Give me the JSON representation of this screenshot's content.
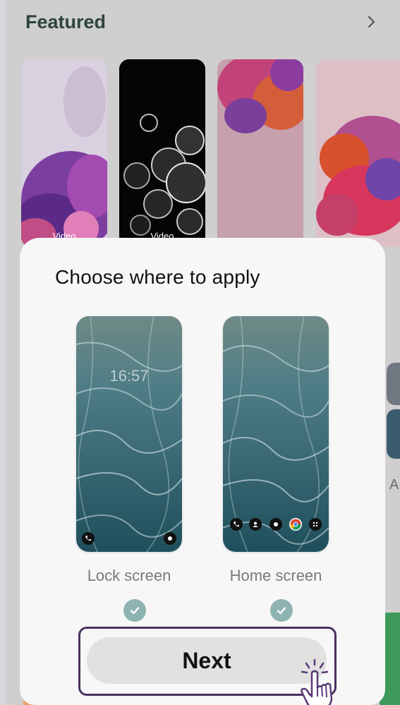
{
  "featured": {
    "title": "Featured",
    "items": [
      {
        "badge": "Video",
        "style": "purple-flowers"
      },
      {
        "badge": "Video",
        "style": "bubbles-dark"
      },
      {
        "badge": "",
        "style": "pink-flowers"
      },
      {
        "badge": "",
        "style": "pink-red-flowers"
      }
    ]
  },
  "sheet": {
    "title": "Choose where to apply",
    "options": [
      {
        "label": "Lock screen",
        "clock": "16:57",
        "checked": true
      },
      {
        "label": "Home screen",
        "checked": true
      }
    ],
    "next_label": "Next"
  },
  "background": {
    "peek_text": "A"
  },
  "colors": {
    "check_bg": "#8fb3b0",
    "highlight_outline": "#4a3160",
    "next_bg": "#e1e1e1"
  },
  "icons": [
    "chevron-right-icon",
    "phone-icon",
    "camera-icon",
    "contacts-icon",
    "chrome-icon",
    "apps-grid-icon",
    "checkmark-icon",
    "tap-hand-icon"
  ]
}
